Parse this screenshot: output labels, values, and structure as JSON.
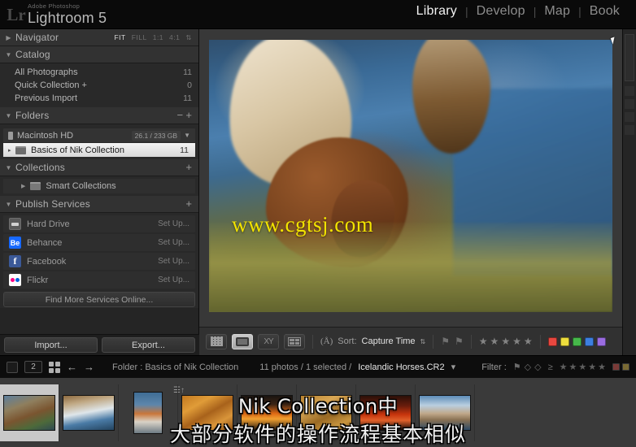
{
  "titlebar": {
    "logo_glyph": "Lr",
    "brand_sup": "Adobe Photoshop",
    "brand_main": "Lightroom 5",
    "modules": [
      {
        "label": "Library",
        "active": true
      },
      {
        "label": "Develop",
        "active": false
      },
      {
        "label": "Map",
        "active": false
      },
      {
        "label": "Book",
        "active": false
      }
    ],
    "separator": "|"
  },
  "left_panel": {
    "navigator": {
      "title": "Navigator",
      "collapsed_triangle": "▶",
      "modes": [
        "FIT",
        "FILL",
        "1:1",
        "4:1"
      ],
      "active_mode": "FIT",
      "stepper": "⇅"
    },
    "catalog": {
      "title": "Catalog",
      "triangle": "▼",
      "items": [
        {
          "label": "All Photographs",
          "count": "11"
        },
        {
          "label": "Quick Collection  +",
          "count": "0"
        },
        {
          "label": "Previous Import",
          "count": "11"
        }
      ]
    },
    "folders": {
      "title": "Folders",
      "triangle": "▼",
      "minus": "−",
      "plus": "+",
      "drive": {
        "label": "Macintosh HD",
        "usage": "26.1 / 233 GB",
        "caret": "▼"
      },
      "folder": {
        "label": "Basics of Nik Collection",
        "count": "11",
        "expander": "▸"
      }
    },
    "collections": {
      "title": "Collections",
      "triangle": "▼",
      "plus": "+",
      "items": [
        {
          "label": "Smart Collections",
          "triangle": "▶"
        }
      ]
    },
    "publish_services": {
      "title": "Publish Services",
      "triangle": "▼",
      "plus": "+",
      "items": [
        {
          "label": "Hard Drive",
          "action": "Set Up...",
          "icon": "hard-drive-icon",
          "glyph": ""
        },
        {
          "label": "Behance",
          "action": "Set Up...",
          "icon": "behance-icon",
          "glyph": "Be"
        },
        {
          "label": "Facebook",
          "action": "Set Up...",
          "icon": "facebook-icon",
          "glyph": "f"
        },
        {
          "label": "Flickr",
          "action": "Set Up...",
          "icon": "flickr-icon",
          "glyph": ""
        }
      ],
      "find_more": "Find More Services Online..."
    },
    "bottom_buttons": {
      "import": "Import...",
      "export": "Export..."
    }
  },
  "image_area": {
    "watermark": "www.cgtsj.com",
    "photo_description": "Icelandic horse drinking at water's edge"
  },
  "toolbar": {
    "view_buttons": [
      {
        "name": "grid-view",
        "active": false
      },
      {
        "name": "loupe-view",
        "active": true
      },
      {
        "name": "compare-view",
        "active": false
      },
      {
        "name": "survey-view",
        "active": false
      }
    ],
    "sort_icon": "♪",
    "sort_label": "Sort:",
    "sort_value": "Capture Time",
    "sort_caret": "⇅",
    "flag_pick": "⚑",
    "flag_reject": "⚑",
    "star_count": 5,
    "star_glyph": "★",
    "swatch_colors": [
      "#e8473f",
      "#eddd3d",
      "#46b84a",
      "#3d7fe0",
      "#9a6ce0"
    ],
    "end_caret": "▼"
  },
  "filter_bar": {
    "page_number": "2",
    "back_arrow": "←",
    "forward_arrow": "→",
    "source_label": "Folder : Basics of Nik Collection",
    "photo_count": "11 photos / 1 selected /",
    "selected_file": "Icelandic Horses.CR2",
    "file_caret": "▾",
    "filter_label": "Filter :",
    "flag_glyphs": [
      "⚑",
      "◇",
      "◇"
    ],
    "rating_prefix": "≥",
    "star_glyph": "★",
    "star_count": 5,
    "color_chips": [
      "#7a3a37",
      "#7a6a33"
    ]
  },
  "filmstrip": {
    "sort_indicator": "☰↑",
    "thumbnails": [
      {
        "name": "thumb-icelandic-horses",
        "selected": true,
        "orientation": "landscape",
        "gradient": "linear-gradient(160deg,#5d7f9e 0%,#8f7f5e 30%,#7a5530 55%,#4d6a3a 78%,#2f4a52 100%)"
      },
      {
        "name": "thumb-waterfall",
        "selected": false,
        "orientation": "landscape",
        "gradient": "linear-gradient(170deg,#8d6a3f 0%,#c0a884 22%,#dfe6ea 48%,#4a7ba6 72%,#24445f 100%)"
      },
      {
        "name": "thumb-puffin",
        "selected": false,
        "orientation": "portrait",
        "gradient": "linear-gradient(180deg,#3f6d95 0%,#5d86ab 30%,#c9763a 52%,#d8d2c6 72%,#6d7a84 100%)"
      },
      {
        "name": "thumb-sand-dunes",
        "selected": false,
        "orientation": "landscape",
        "gradient": "linear-gradient(150deg,#c2781f 0%,#e09c38 28%,#a8621b 52%,#d9953a 76%,#8a4f16 100%)"
      },
      {
        "name": "thumb-sunset-pier",
        "selected": false,
        "orientation": "landscape",
        "gradient": "linear-gradient(180deg,#1a1410 0%,#3a2314 25%,#e06a14 52%,#f0a030 68%,#2a1a10 100%)"
      },
      {
        "name": "thumb-desert-texture",
        "selected": false,
        "orientation": "landscape",
        "gradient": "linear-gradient(155deg,#b8822e 0%,#d9a754 30%,#9a6a24 58%,#c9963f 82%,#7d5418 100%)"
      },
      {
        "name": "thumb-red-sky",
        "selected": false,
        "orientation": "landscape",
        "gradient": "linear-gradient(180deg,#2a0f08 0%,#6b1d0c 30%,#c8350d 55%,#e0602a 72%,#1a0a06 100%)"
      },
      {
        "name": "thumb-venice-canal",
        "selected": false,
        "orientation": "landscape",
        "gradient": "linear-gradient(180deg,#5d8cb8 0%,#b9cee0 28%,#c0a88a 52%,#8a7254 70%,#2d4a66 100%)"
      }
    ]
  },
  "subtitles": {
    "line_en": "Nik Collection中",
    "line_cn": "大部分软件的操作流程基本相似"
  }
}
